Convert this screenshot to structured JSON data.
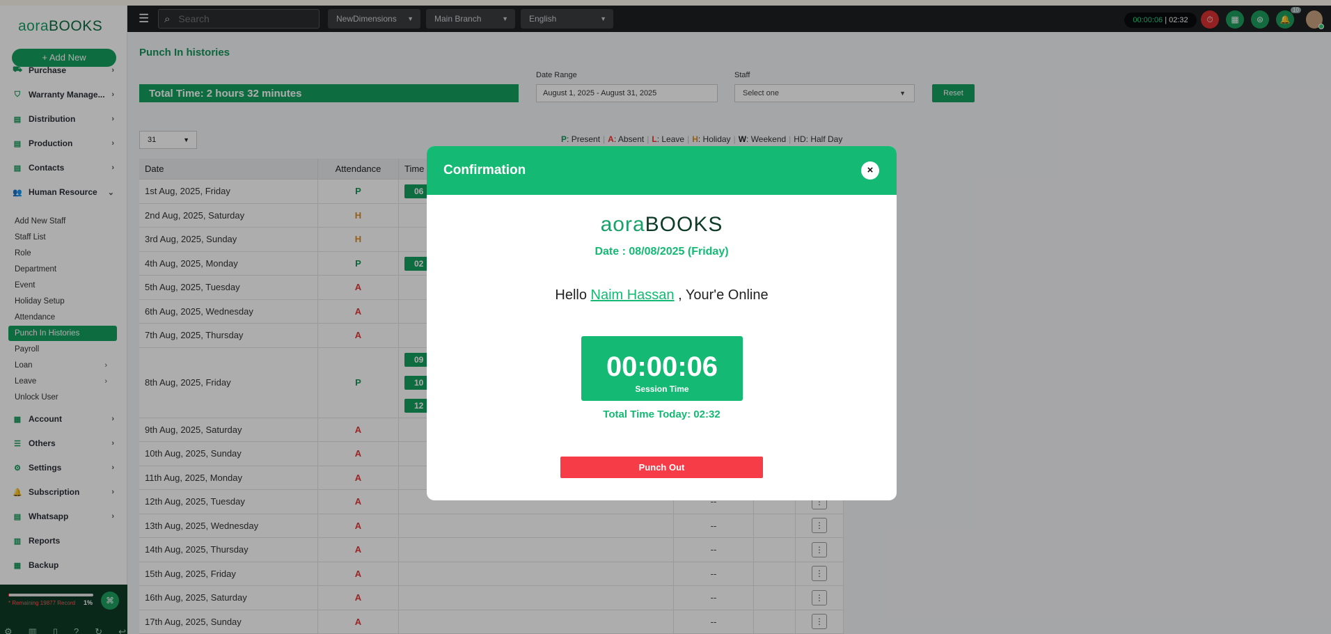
{
  "app": {
    "logo_primary": "aora",
    "logo_secondary": "BOOKS",
    "add_new_label": "+ Add New"
  },
  "sidebar": {
    "top_items": [
      {
        "label": "Purchase",
        "icon": "cart-icon"
      },
      {
        "label": "Warranty Manage...",
        "icon": "warranty-icon"
      },
      {
        "label": "Distribution",
        "icon": "document-icon"
      },
      {
        "label": "Production",
        "icon": "document-icon"
      },
      {
        "label": "Contacts",
        "icon": "document-icon"
      },
      {
        "label": "Human Resource",
        "icon": "users-icon"
      }
    ],
    "hr_sub_items": [
      {
        "label": "Add New Staff"
      },
      {
        "label": "Staff List"
      },
      {
        "label": "Role"
      },
      {
        "label": "Department"
      },
      {
        "label": "Event"
      },
      {
        "label": "Holiday Setup"
      },
      {
        "label": "Attendance"
      },
      {
        "label": "Punch In Histories"
      },
      {
        "label": "Payroll"
      },
      {
        "label": "Loan"
      },
      {
        "label": "Leave"
      },
      {
        "label": "Unlock User"
      }
    ],
    "bottom_items": [
      {
        "label": "Account",
        "icon": "calculator-icon"
      },
      {
        "label": "Others",
        "icon": "list-icon"
      },
      {
        "label": "Settings",
        "icon": "gear-icon"
      },
      {
        "label": "Subscription",
        "icon": "bell-icon"
      },
      {
        "label": "Whatsapp",
        "icon": "document-icon"
      },
      {
        "label": "Reports",
        "icon": "bar-chart-icon"
      },
      {
        "label": "Backup",
        "icon": "grid-icon"
      }
    ],
    "storage": {
      "remaining_text": "* Remaining 19877 Record",
      "percent_text": "1%",
      "percent_used": 1
    }
  },
  "topbar": {
    "search_placeholder": "Search",
    "company_select": "NewDimensions",
    "branch_select": "Main Branch",
    "language_select": "English",
    "session_timer": "00:00:06",
    "total_timer": "02:32",
    "notification_count": "10"
  },
  "page": {
    "title": "Punch In histories",
    "total_time": "Total Time: 2 hours 32 minutes",
    "date_range_label": "Date Range",
    "date_range_value": "August 1, 2025 - August 31, 2025",
    "staff_label": "Staff",
    "staff_placeholder": "Select one",
    "reset_label": "Reset",
    "page_size": "31"
  },
  "legend": [
    {
      "code": "P",
      "label": "Present"
    },
    {
      "code": "A",
      "label": "Absent"
    },
    {
      "code": "L",
      "label": "Leave"
    },
    {
      "code": "H",
      "label": "Holiday"
    },
    {
      "code": "W",
      "label": "Weekend"
    },
    {
      "code": "HD",
      "label": "Half Day"
    }
  ],
  "table": {
    "headers": [
      "Date",
      "Attendance",
      "Time"
    ],
    "rows": [
      {
        "date": "1st Aug, 2025, Friday",
        "att": "P",
        "chips": [
          "06"
        ],
        "dash": ""
      },
      {
        "date": "2nd Aug, 2025, Saturday",
        "att": "H",
        "chips": [],
        "dash": ""
      },
      {
        "date": "3rd Aug, 2025, Sunday",
        "att": "H",
        "chips": [],
        "dash": ""
      },
      {
        "date": "4th Aug, 2025, Monday",
        "att": "P",
        "chips": [
          "02"
        ],
        "dash": ""
      },
      {
        "date": "5th Aug, 2025, Tuesday",
        "att": "A",
        "chips": [],
        "dash": ""
      },
      {
        "date": "6th Aug, 2025, Wednesday",
        "att": "A",
        "chips": [],
        "dash": ""
      },
      {
        "date": "7th Aug, 2025, Thursday",
        "att": "A",
        "chips": [],
        "dash": ""
      },
      {
        "date": "8th Aug, 2025, Friday",
        "att": "P",
        "chips": [
          "09",
          "10",
          "12"
        ],
        "dash": ""
      },
      {
        "date": "9th Aug, 2025, Saturday",
        "att": "A",
        "chips": [],
        "dash": ""
      },
      {
        "date": "10th Aug, 2025, Sunday",
        "att": "A",
        "chips": [],
        "dash": ""
      },
      {
        "date": "11th Aug, 2025, Monday",
        "att": "A",
        "chips": [],
        "dash": ""
      },
      {
        "date": "12th Aug, 2025, Tuesday",
        "att": "A",
        "chips": [],
        "dash": "--"
      },
      {
        "date": "13th Aug, 2025, Wednesday",
        "att": "A",
        "chips": [],
        "dash": "--"
      },
      {
        "date": "14th Aug, 2025, Thursday",
        "att": "A",
        "chips": [],
        "dash": "--"
      },
      {
        "date": "15th Aug, 2025, Friday",
        "att": "A",
        "chips": [],
        "dash": "--"
      },
      {
        "date": "16th Aug, 2025, Saturday",
        "att": "A",
        "chips": [],
        "dash": "--"
      },
      {
        "date": "17th Aug, 2025, Sunday",
        "att": "A",
        "chips": [],
        "dash": "--"
      }
    ]
  },
  "modal": {
    "title": "Confirmation",
    "close_glyph": "×",
    "logo_primary": "aora",
    "logo_secondary": "BOOKS",
    "date_text": "Date : 08/08/2025 (Friday)",
    "hello_prefix": "Hello",
    "user_name": "Naim Hassan",
    "hello_suffix": ", Your'e Online",
    "session_time": "00:00:06",
    "session_label": "Session Time",
    "total_today": "Total Time Today: 02:32",
    "punch_out_label": "Punch Out"
  },
  "colors": {
    "brand_green": "#15a15f",
    "modal_green": "#14ba73",
    "danger_red": "#f53c47",
    "holiday_orange": "#e08a1e"
  }
}
